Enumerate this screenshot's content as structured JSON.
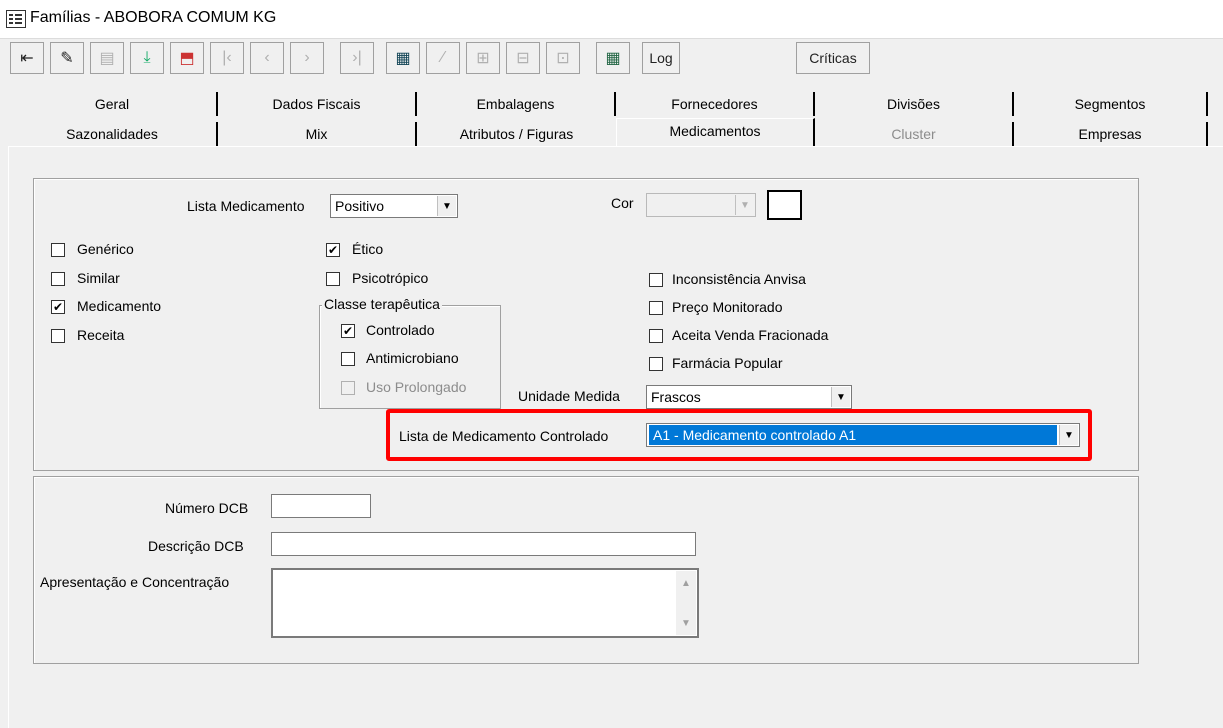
{
  "window": {
    "title": "Famílias - ABOBORA COMUM KG"
  },
  "toolbar": {
    "buttons": [
      {
        "icon": "exit-icon",
        "glyph": "⇤"
      },
      {
        "icon": "eraser-icon",
        "glyph": "✎"
      },
      {
        "icon": "new-icon",
        "glyph": "▤"
      },
      {
        "icon": "save-icon",
        "glyph": "⤓"
      },
      {
        "icon": "delete-icon",
        "glyph": "⬒"
      },
      {
        "icon": "first-record-icon",
        "glyph": "|‹"
      },
      {
        "icon": "prev-record-icon",
        "glyph": "‹"
      },
      {
        "icon": "next-record-icon",
        "glyph": "›"
      },
      {
        "icon": "last-record-icon",
        "glyph": "›|"
      },
      {
        "icon": "grid-icon",
        "glyph": "▦"
      },
      {
        "icon": "filter-icon",
        "glyph": "⁄"
      },
      {
        "icon": "insert-icon",
        "glyph": "⊞"
      },
      {
        "icon": "append-icon",
        "glyph": "⊟"
      },
      {
        "icon": "remove-icon",
        "glyph": "⊡"
      },
      {
        "icon": "export-grid-icon",
        "glyph": "▦"
      }
    ],
    "log_label": "Log",
    "criticas_label": "Críticas"
  },
  "tabs": {
    "row1": [
      "Geral",
      "Dados Fiscais",
      "Embalagens",
      "Fornecedores",
      "Divisões",
      "Segmentos"
    ],
    "row2": [
      "Sazonalidades",
      "Mix",
      "Atributos / Figuras",
      "Medicamentos",
      "Cluster",
      "Empresas"
    ],
    "active": "Medicamentos",
    "disabled": "Cluster"
  },
  "form": {
    "lista_medicamento_label": "Lista Medicamento",
    "lista_medicamento_value": "Positivo",
    "cor_label": "Cor",
    "cor_value": "",
    "checkboxes_left": [
      {
        "label": "Genérico",
        "checked": false
      },
      {
        "label": "Similar",
        "checked": false
      },
      {
        "label": "Medicamento",
        "checked": true
      },
      {
        "label": "Receita",
        "checked": false
      }
    ],
    "etico_label": "Ético",
    "etico_checked": true,
    "psicotropico_label": "Psicotrópico",
    "psicotropico_checked": false,
    "classe_terapeutica": {
      "legend": "Classe terapêutica",
      "items": [
        {
          "label": "Controlado",
          "checked": true,
          "disabled": false
        },
        {
          "label": "Antimicrobiano",
          "checked": false,
          "disabled": false
        },
        {
          "label": "Uso Prolongado",
          "checked": false,
          "disabled": true
        }
      ]
    },
    "checkboxes_right": [
      {
        "label": "Inconsistência Anvisa",
        "checked": false
      },
      {
        "label": "Preço Monitorado",
        "checked": false
      },
      {
        "label": "Aceita Venda Fracionada",
        "checked": false
      },
      {
        "label": "Farmácia Popular",
        "checked": false
      }
    ],
    "unidade_medida_label": "Unidade Medida",
    "unidade_medida_value": "Frascos",
    "lista_controlado_label": "Lista de Medicamento Controlado",
    "lista_controlado_value": "A1 - Medicamento controlado A1",
    "numero_dcb_label": "Número DCB",
    "numero_dcb_value": "",
    "descricao_dcb_label": "Descrição DCB",
    "descricao_dcb_value": "",
    "apresentacao_label": "Apresentação e Concentração",
    "apresentacao_value": ""
  },
  "colors": {
    "highlight": "#ff0000",
    "selection": "#0078d7"
  }
}
